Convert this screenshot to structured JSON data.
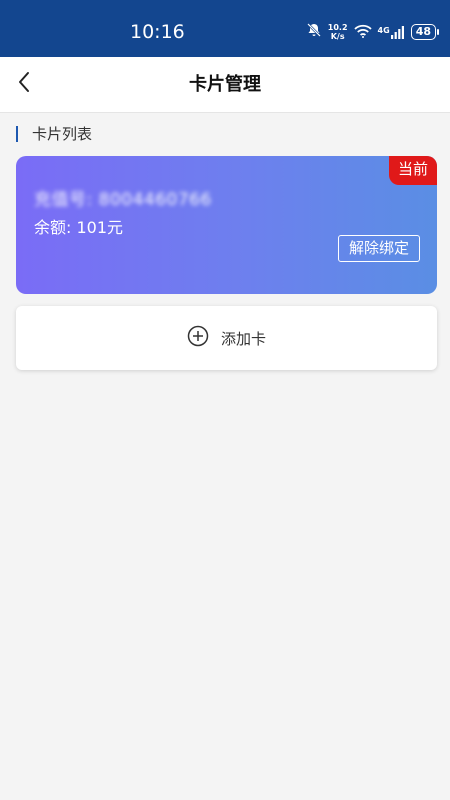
{
  "status_bar": {
    "time": "10:16",
    "net_speed_value": "10.2",
    "net_speed_unit": "K/s",
    "signal_label": "4G",
    "battery": "48"
  },
  "header": {
    "title": "卡片管理"
  },
  "section": {
    "title": "卡片列表"
  },
  "card": {
    "badge": "当前",
    "number": "充值号: 8004460766",
    "balance": "余额: 101元",
    "unbind_label": "解除绑定"
  },
  "add_card": {
    "label": "添加卡"
  },
  "colors": {
    "status_bar_bg": "#13468f",
    "badge_red": "#e01919",
    "card_gradient_start": "#7a6cf6",
    "card_gradient_end": "#5a8ee4"
  }
}
